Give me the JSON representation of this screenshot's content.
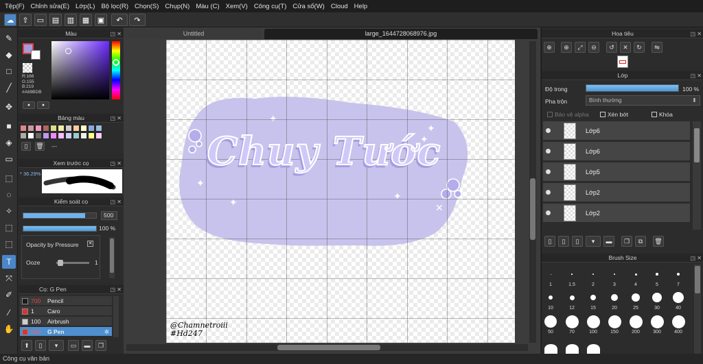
{
  "menu": [
    "Tệp(F)",
    "Chỉnh sửa(E)",
    "Lớp(L)",
    "Bộ lọc(R)",
    "Chọn(S)",
    "Chụp(N)",
    "Màu (C)",
    "Xem(V)",
    "Công cụ(T)",
    "Cửa sổ(W)",
    "Cloud",
    "Help"
  ],
  "tabs": {
    "untitled": "Untitled",
    "file": "large_1644728068976.jpg"
  },
  "color_panel": {
    "title": "Màu",
    "r": "R:166",
    "g": "G:155",
    "b": "B:219",
    "hex": "#A69BDB",
    "accent": "#A69BDB"
  },
  "palette_panel": {
    "title": "Bảng màu",
    "extra": "---"
  },
  "preview_panel": {
    "title": "Xem trước cọ",
    "zoom": "36.29%"
  },
  "brush_control": {
    "title": "Kiểm soát cọ",
    "size": "500",
    "opacity": "100 %",
    "pressure_label": "Opacity by Pressure",
    "ooze_label": "Ooze",
    "ooze_value": "1",
    "size_fraction": 0.85,
    "opacity_fraction": 1.0
  },
  "brush_list": {
    "title": "Cọ: G Pen",
    "items": [
      {
        "size": "700",
        "name": "Pencil",
        "color": "#1a1a1a"
      },
      {
        "size": "1",
        "name": "Caro",
        "color": "#e03030"
      },
      {
        "size": "100",
        "name": "Airbrush",
        "color": "#cfcfcf"
      },
      {
        "size": "500",
        "name": "G Pen",
        "color": "#e03030"
      }
    ]
  },
  "canvas": {
    "title_text": "Chuy Tước",
    "watermark1": "@Chamnetroiii",
    "watermark2": "#Hd247",
    "blob_color": "#c8c3ec"
  },
  "navigator": {
    "title": "Hoa tiêu"
  },
  "layers_panel": {
    "title": "Lớp",
    "opacity_label": "Độ trong",
    "opacity_value": "100 %",
    "blend_label": "Pha trộn",
    "blend_value": "Bình thường",
    "protect_alpha": "Bảo vệ alpha",
    "clip": "Xén bớt",
    "lock": "Khóa",
    "layers": [
      "Lớp6",
      "Lớp6",
      "Lớp5",
      "Lớp2",
      "Lớp2"
    ]
  },
  "brush_size": {
    "title": "Brush Size",
    "row1": [
      "1",
      "1.5",
      "2",
      "3",
      "4",
      "5",
      "7"
    ],
    "row2": [
      "10",
      "12",
      "15",
      "20",
      "25",
      "30",
      "40"
    ],
    "row3": [
      "50",
      "70",
      "100",
      "150",
      "200",
      "300",
      "400"
    ]
  },
  "status": "Công cụ văn bản"
}
